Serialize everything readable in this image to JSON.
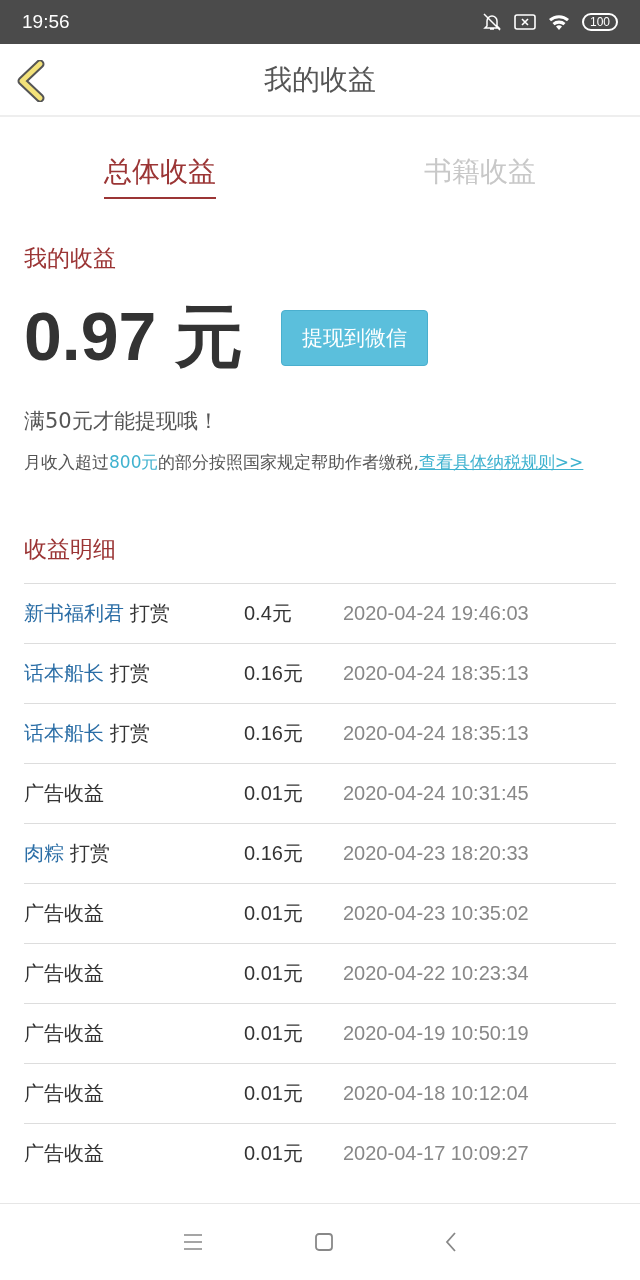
{
  "status_bar": {
    "time": "19:56",
    "battery": "100"
  },
  "header": {
    "title": "我的收益"
  },
  "tabs": [
    {
      "label": "总体收益",
      "selected": true
    },
    {
      "label": "书籍收益",
      "selected": false
    }
  ],
  "earnings": {
    "label": "我的收益",
    "amount": "0.97 元",
    "withdraw_button": "提现到微信",
    "notice": "满50元才能提现哦！",
    "tax_note": "月收入超过",
    "tax_amount": "800元",
    "tax_note_rest": "的部分按照国家规定帮助作者缴税,",
    "tax_link": "查看具体纳税规则>>"
  },
  "details": {
    "title": "收益明细",
    "rows": [
      {
        "kind": "tip",
        "user": "新书福利君",
        "action": "打赏",
        "amount": "0.4元",
        "time": "2020-04-24 19:46:03"
      },
      {
        "kind": "tip",
        "user": "话本船长",
        "action": "打赏",
        "amount": "0.16元",
        "time": "2020-04-24 18:35:13"
      },
      {
        "kind": "tip",
        "user": "话本船长",
        "action": "打赏",
        "amount": "0.16元",
        "time": "2020-04-24 18:35:13"
      },
      {
        "kind": "ad",
        "action": "广告收益",
        "amount": "0.01元",
        "time": "2020-04-24 10:31:45"
      },
      {
        "kind": "tip",
        "user": "肉粽",
        "action": "打赏",
        "amount": "0.16元",
        "time": "2020-04-23 18:20:33"
      },
      {
        "kind": "ad",
        "action": "广告收益",
        "amount": "0.01元",
        "time": "2020-04-23 10:35:02"
      },
      {
        "kind": "ad",
        "action": "广告收益",
        "amount": "0.01元",
        "time": "2020-04-22 10:23:34"
      },
      {
        "kind": "ad",
        "action": "广告收益",
        "amount": "0.01元",
        "time": "2020-04-19 10:50:19"
      },
      {
        "kind": "ad",
        "action": "广告收益",
        "amount": "0.01元",
        "time": "2020-04-18 10:12:04"
      },
      {
        "kind": "ad",
        "action": "广告收益",
        "amount": "0.01元",
        "time": "2020-04-17 10:09:27"
      }
    ]
  }
}
